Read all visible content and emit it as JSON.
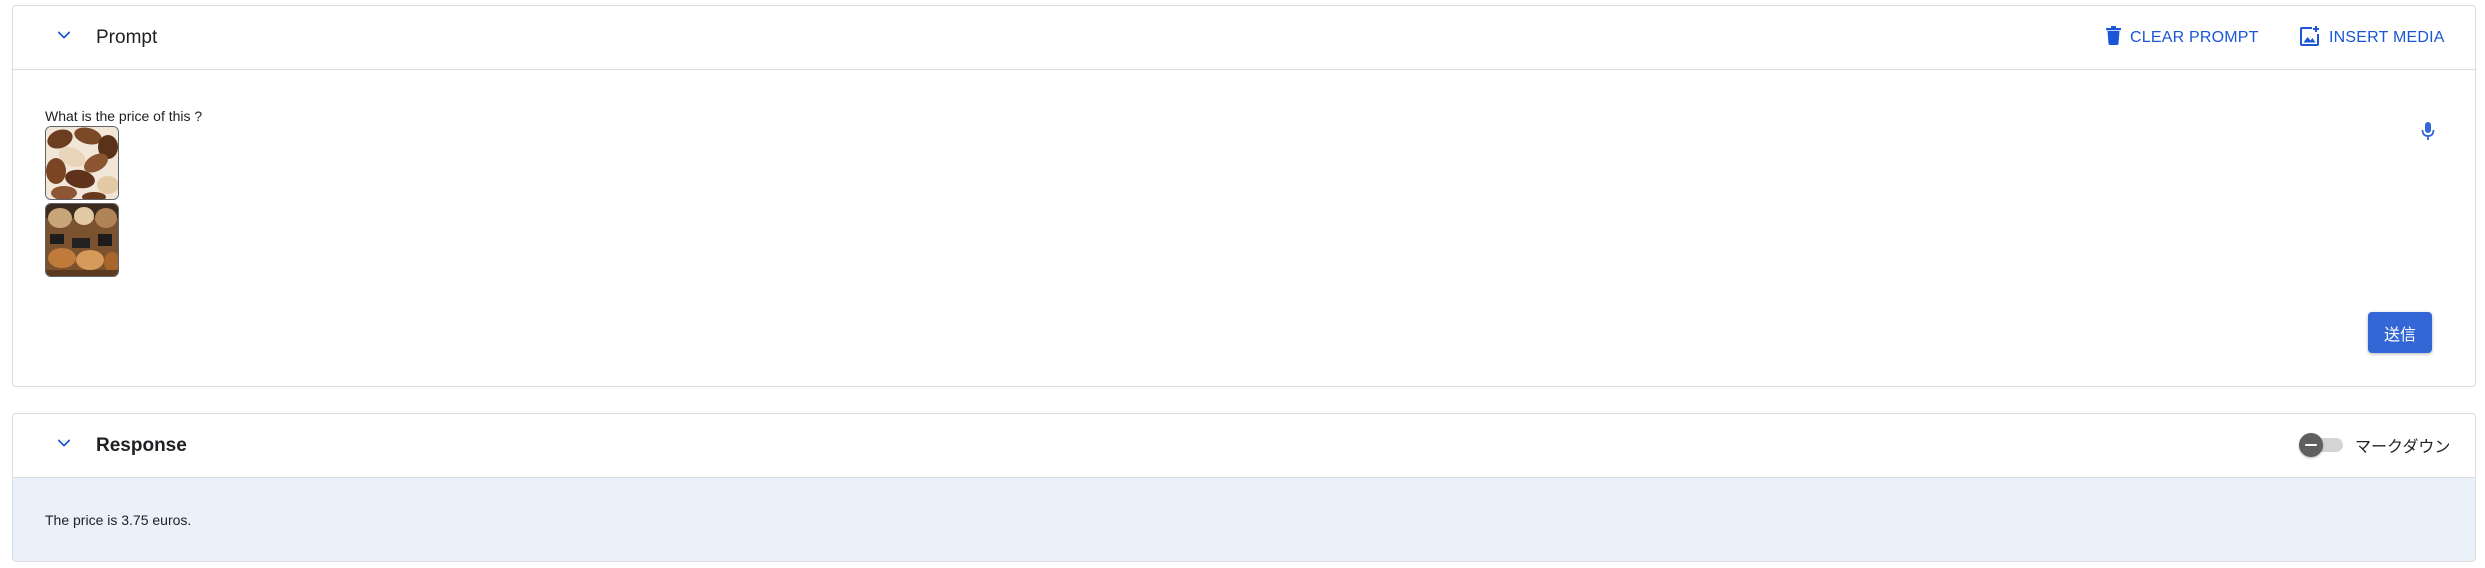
{
  "colors": {
    "accent": "#1a56d6",
    "send_button_bg": "#3367d6",
    "response_bg": "#eaf1fb",
    "border": "#dadce0"
  },
  "prompt_panel": {
    "title": "Prompt",
    "collapse_icon": "chevron-down-icon",
    "clear_prompt": {
      "label": "CLEAR PROMPT",
      "icon": "trash-icon"
    },
    "insert_media": {
      "label": "INSERT MEDIA",
      "icon": "add-photo-icon"
    },
    "prompt_text": "What is the price of this ?",
    "attachments": [
      "image-thumbnail",
      "image-thumbnail"
    ],
    "mic_icon": "microphone-icon",
    "send_label": "送信"
  },
  "response_panel": {
    "title": "Response",
    "collapse_icon": "chevron-down-icon",
    "markdown_toggle": {
      "label": "マークダウン",
      "on": false
    },
    "response_text": "The price is 3.75 euros."
  }
}
